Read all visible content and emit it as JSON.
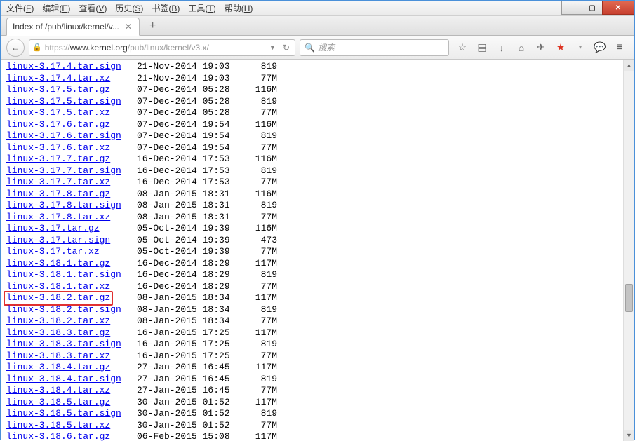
{
  "titlebar": {
    "menus": [
      "文件(F)",
      "编辑(E)",
      "查看(V)",
      "历史(S)",
      "书签(B)",
      "工具(T)",
      "帮助(H)"
    ]
  },
  "tab": {
    "title": "Index of /pub/linux/kernel/v..."
  },
  "url": {
    "scheme": "https://",
    "host": "www.kernel.org",
    "path": "/pub/linux/kernel/v3.x/"
  },
  "search": {
    "placeholder": "搜索"
  },
  "highlighted_index": 20,
  "files": [
    {
      "name": "linux-3.17.4.tar.sign",
      "date": "21-Nov-2014 19:03",
      "size": "819"
    },
    {
      "name": "linux-3.17.4.tar.xz",
      "date": "21-Nov-2014 19:03",
      "size": "77M"
    },
    {
      "name": "linux-3.17.5.tar.gz",
      "date": "07-Dec-2014 05:28",
      "size": "116M"
    },
    {
      "name": "linux-3.17.5.tar.sign",
      "date": "07-Dec-2014 05:28",
      "size": "819"
    },
    {
      "name": "linux-3.17.5.tar.xz",
      "date": "07-Dec-2014 05:28",
      "size": "77M"
    },
    {
      "name": "linux-3.17.6.tar.gz",
      "date": "07-Dec-2014 19:54",
      "size": "116M"
    },
    {
      "name": "linux-3.17.6.tar.sign",
      "date": "07-Dec-2014 19:54",
      "size": "819"
    },
    {
      "name": "linux-3.17.6.tar.xz",
      "date": "07-Dec-2014 19:54",
      "size": "77M"
    },
    {
      "name": "linux-3.17.7.tar.gz",
      "date": "16-Dec-2014 17:53",
      "size": "116M"
    },
    {
      "name": "linux-3.17.7.tar.sign",
      "date": "16-Dec-2014 17:53",
      "size": "819"
    },
    {
      "name": "linux-3.17.7.tar.xz",
      "date": "16-Dec-2014 17:53",
      "size": "77M"
    },
    {
      "name": "linux-3.17.8.tar.gz",
      "date": "08-Jan-2015 18:31",
      "size": "116M"
    },
    {
      "name": "linux-3.17.8.tar.sign",
      "date": "08-Jan-2015 18:31",
      "size": "819"
    },
    {
      "name": "linux-3.17.8.tar.xz",
      "date": "08-Jan-2015 18:31",
      "size": "77M"
    },
    {
      "name": "linux-3.17.tar.gz",
      "date": "05-Oct-2014 19:39",
      "size": "116M"
    },
    {
      "name": "linux-3.17.tar.sign",
      "date": "05-Oct-2014 19:39",
      "size": "473"
    },
    {
      "name": "linux-3.17.tar.xz",
      "date": "05-Oct-2014 19:39",
      "size": "77M"
    },
    {
      "name": "linux-3.18.1.tar.gz",
      "date": "16-Dec-2014 18:29",
      "size": "117M"
    },
    {
      "name": "linux-3.18.1.tar.sign",
      "date": "16-Dec-2014 18:29",
      "size": "819"
    },
    {
      "name": "linux-3.18.1.tar.xz",
      "date": "16-Dec-2014 18:29",
      "size": "77M"
    },
    {
      "name": "linux-3.18.2.tar.gz",
      "date": "08-Jan-2015 18:34",
      "size": "117M"
    },
    {
      "name": "linux-3.18.2.tar.sign",
      "date": "08-Jan-2015 18:34",
      "size": "819"
    },
    {
      "name": "linux-3.18.2.tar.xz",
      "date": "08-Jan-2015 18:34",
      "size": "77M"
    },
    {
      "name": "linux-3.18.3.tar.gz",
      "date": "16-Jan-2015 17:25",
      "size": "117M"
    },
    {
      "name": "linux-3.18.3.tar.sign",
      "date": "16-Jan-2015 17:25",
      "size": "819"
    },
    {
      "name": "linux-3.18.3.tar.xz",
      "date": "16-Jan-2015 17:25",
      "size": "77M"
    },
    {
      "name": "linux-3.18.4.tar.gz",
      "date": "27-Jan-2015 16:45",
      "size": "117M"
    },
    {
      "name": "linux-3.18.4.tar.sign",
      "date": "27-Jan-2015 16:45",
      "size": "819"
    },
    {
      "name": "linux-3.18.4.tar.xz",
      "date": "27-Jan-2015 16:45",
      "size": "77M"
    },
    {
      "name": "linux-3.18.5.tar.gz",
      "date": "30-Jan-2015 01:52",
      "size": "117M"
    },
    {
      "name": "linux-3.18.5.tar.sign",
      "date": "30-Jan-2015 01:52",
      "size": "819"
    },
    {
      "name": "linux-3.18.5.tar.xz",
      "date": "30-Jan-2015 01:52",
      "size": "77M"
    },
    {
      "name": "linux-3.18.6.tar.gz",
      "date": "06-Feb-2015 15:08",
      "size": "117M"
    }
  ]
}
